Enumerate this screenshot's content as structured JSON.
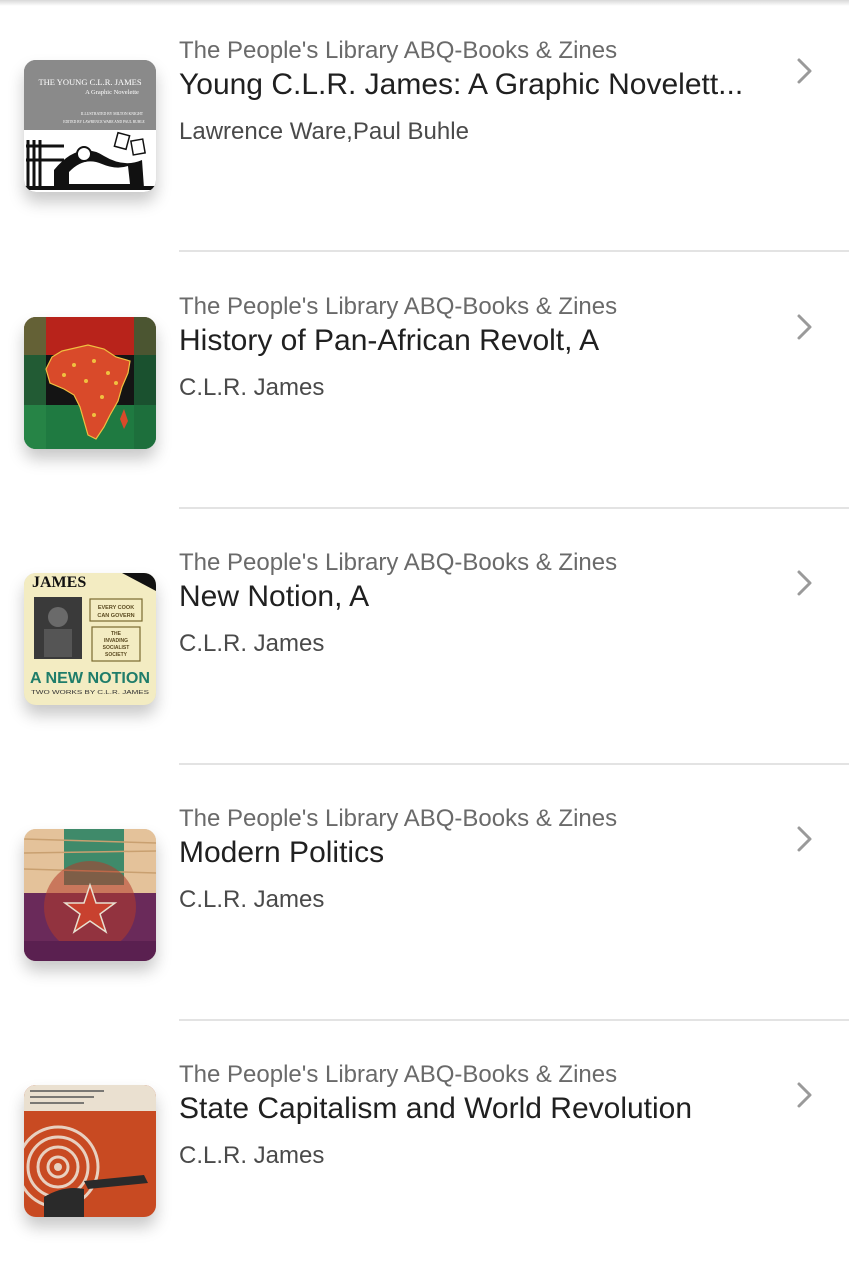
{
  "colors": {
    "store_text": "#6a6a6a",
    "title_text": "#202020",
    "author_text": "#4a4a4a",
    "chevron": "#9a9a9a",
    "divider": "#e3e3e3"
  },
  "books": [
    {
      "store": "The People's Library ABQ-Books & Zines",
      "title": "Young C.L.R. James: A Graphic Novelett...",
      "author": "Lawrence Ware,Paul Buhle",
      "cover": {
        "line1": "THE YOUNG C.L.R. JAMES",
        "line2": "A Graphic Novelette",
        "line3": "ILLUSTRATED BY MILTON KNIGHT",
        "line4": "EDITED BY LAWRENCE WARE AND PAUL BUHLE"
      }
    },
    {
      "store": "The People's Library ABQ-Books & Zines",
      "title": "History of Pan-African Revolt, A",
      "author": "C.L.R. James",
      "cover": {}
    },
    {
      "store": "The People's Library ABQ-Books & Zines",
      "title": "New Notion, A",
      "author": "C.L.R. James",
      "cover": {
        "top": "JAMES",
        "box1a": "EVERY COOK",
        "box1b": "CAN GOVERN",
        "box2a": "THE",
        "box2b": "INVADING",
        "box2c": "SOCIALIST",
        "box2d": "SOCIETY",
        "main": "A NEW NOTION",
        "sub": "TWO WORKS BY C.L.R. JAMES"
      }
    },
    {
      "store": "The People's Library ABQ-Books & Zines",
      "title": "Modern Politics",
      "author": "C.L.R. James",
      "cover": {}
    },
    {
      "store": "The People's Library ABQ-Books & Zines",
      "title": "State Capitalism and World Revolution",
      "author": "C.L.R. James",
      "cover": {}
    }
  ]
}
